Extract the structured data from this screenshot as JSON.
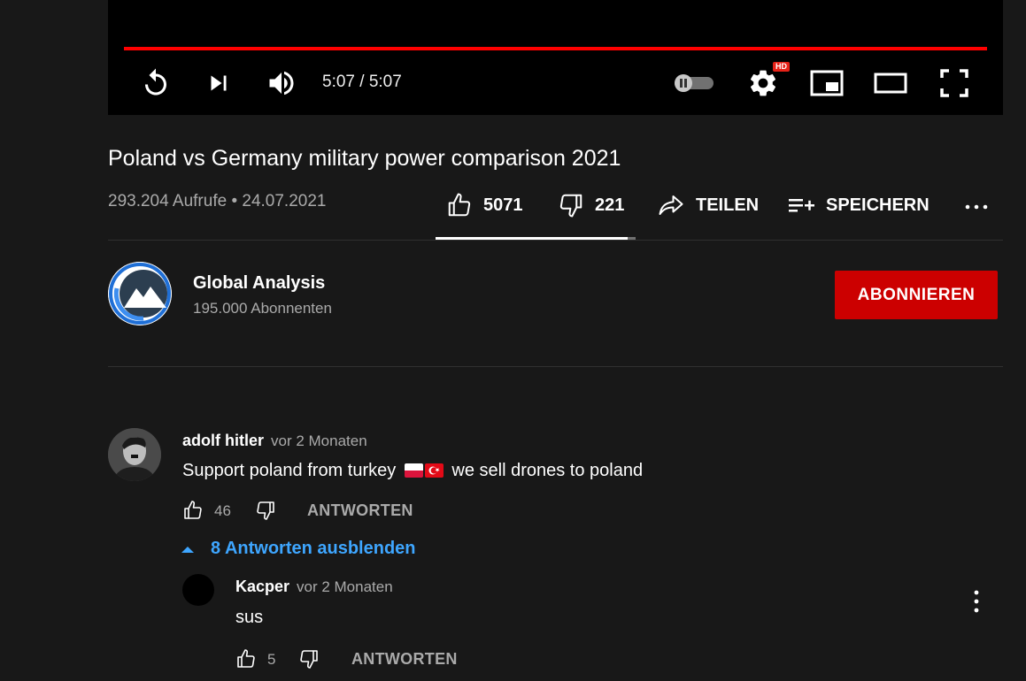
{
  "player": {
    "time_display": "5:07 / 5:07",
    "progress": 1.0,
    "hd_badge": "HD",
    "icons": [
      "replay-icon",
      "next-icon",
      "volume-icon",
      "autoplay-toggle",
      "settings-icon",
      "miniplayer-icon",
      "theater-icon",
      "fullscreen-icon"
    ]
  },
  "video": {
    "title": "Poland vs Germany military power comparison 2021",
    "views_date": "293.204 Aufrufe • 24.07.2021",
    "likes": "5071",
    "dislikes": "221",
    "share_label": "TEILEN",
    "save_label": "SPEICHERN",
    "like_ratio": 0.958
  },
  "channel": {
    "name": "Global Analysis",
    "subscribers": "195.000 Abonnenten",
    "subscribe_label": "ABONNIEREN"
  },
  "comments": [
    {
      "author": "adolf hitler",
      "time": "vor 2 Monaten",
      "text_before": "Support poland from turkey",
      "text_after": "we sell drones to poland",
      "likes": "46",
      "reply_label": "ANTWORTEN",
      "replies_toggle": "8 Antworten ausblenden"
    },
    {
      "author": "Kacper",
      "time": "vor 2 Monaten",
      "text": "sus",
      "likes": "5",
      "reply_label": "ANTWORTEN"
    }
  ],
  "colors": {
    "background": "#181818",
    "progress": "#ff0000",
    "subscribe": "#cc0000",
    "link_blue": "#3ea6ff"
  }
}
